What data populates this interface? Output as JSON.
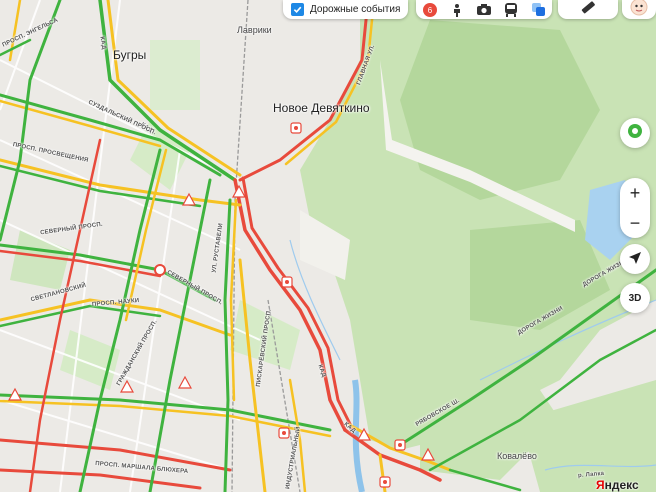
{
  "toolbar": {
    "traffic_events_label": "Дорожные события",
    "traffic_events_checked": true,
    "layers": [
      {
        "icon": "traffic-score-icon",
        "badge": "6"
      },
      {
        "icon": "panorama-icon"
      },
      {
        "icon": "camera-icon"
      },
      {
        "icon": "transit-icon"
      },
      {
        "icon": "layers-icon"
      }
    ],
    "ruler_icon": "ruler-icon",
    "profile_icon": "avatar-icon"
  },
  "map_controls": {
    "zoom_in": "+",
    "zoom_out": "−",
    "mode_3d": "3D"
  },
  "places": {
    "bugry": "Бугры",
    "lavriki": "Лаврики",
    "novoe_devyatkino": "Новое Девяткино",
    "kovalyovo": "Ковалёво"
  },
  "roads": {
    "kad": "КАД",
    "suzdalsky": "СУЗДАЛЬСКИЙ ПРОСП.",
    "prosveshcheniya": "ПРОСП. ПРОСВЕЩЕНИЯ",
    "severny": "СЕВЕРНЫЙ ПРОСП.",
    "nauki": "ПРОСП. НАУКИ",
    "svetlanovsky": "СВЕТЛАНОВСКИЙ",
    "grazhdansky": "ГРАЖДАНСКИЙ ПРОСП.",
    "rustaveli": "УЛ. РУСТАВЕЛИ",
    "piskarevsky": "ПИСКАРЁВСКИЙ ПРОСП.",
    "industrialny": "ИНДУСТРИАЛЬНЫЙ",
    "ryabovskoe": "РЯБОВСКОЕ Ш.",
    "doroga_zhizni": "ДОРОГА ЖИЗНИ",
    "glavnaya": "ГЛАВНАЯ УЛ.",
    "marshala_blyukhera": "ПРОСП. МАРШАЛА БЛЮХЕРА",
    "engelsa": "ПРОСП. ЭНГЕЛЬСА",
    "lapka": "р. Лапка"
  },
  "brand": {
    "first": "Я",
    "rest": "ндекс"
  },
  "colors": {
    "jam": "#e84a3c",
    "slow": "#f6c223",
    "free": "#3fb33f",
    "forest": "#c9e3b5",
    "forest_dark": "#b4d79c",
    "water": "#a9d2f0",
    "accent": "#1e88e5"
  }
}
